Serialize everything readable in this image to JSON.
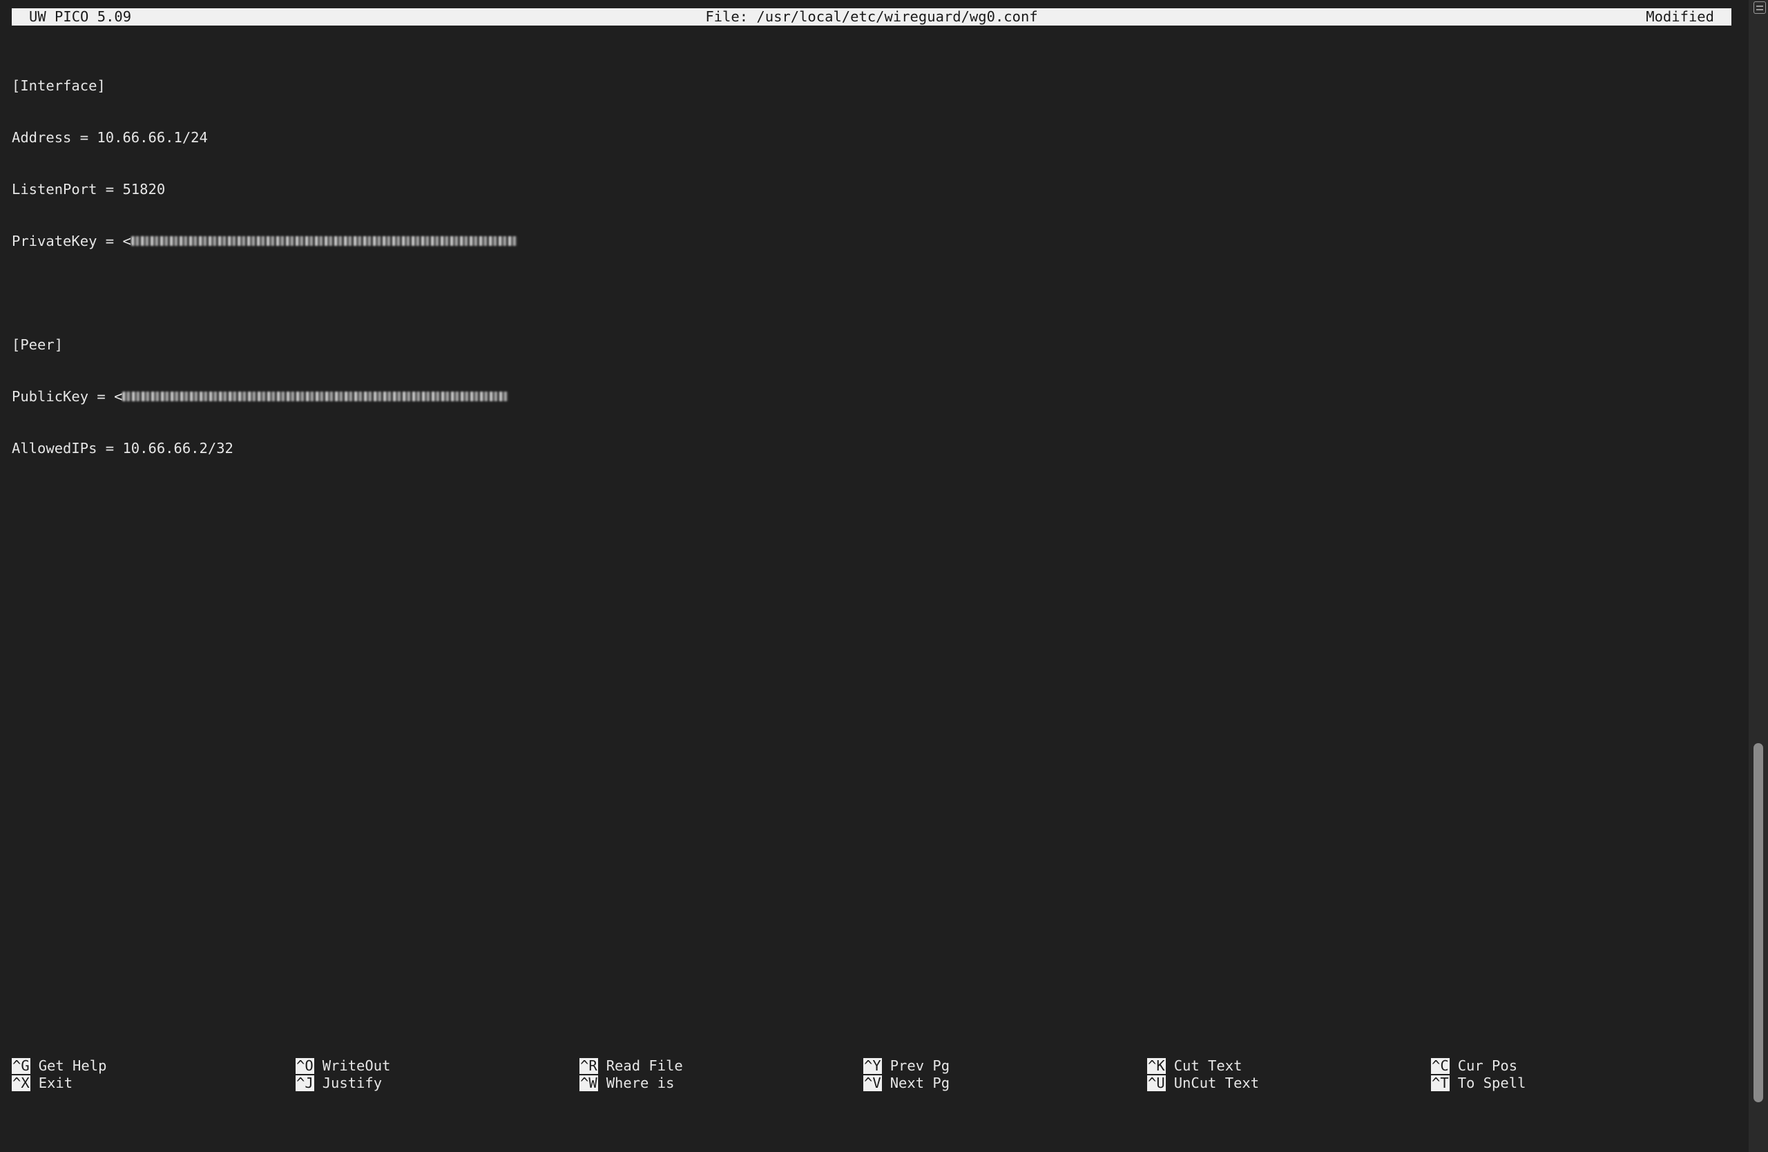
{
  "titlebar": {
    "app": "UW PICO 5.09",
    "file": "File: /usr/local/etc/wireguard/wg0.conf",
    "status": "Modified"
  },
  "editor": {
    "lines": [
      "[Interface]",
      "Address = 10.66.66.1/24",
      "ListenPort = 51820",
      "PrivateKey = <",
      "",
      "[Peer]",
      "PublicKey = <",
      "AllowedIPs = 10.66.66.2/32"
    ]
  },
  "shortcuts": [
    {
      "key": "^G",
      "label": "Get Help"
    },
    {
      "key": "^X",
      "label": "Exit"
    },
    {
      "key": "^O",
      "label": "WriteOut"
    },
    {
      "key": "^J",
      "label": "Justify"
    },
    {
      "key": "^R",
      "label": "Read File"
    },
    {
      "key": "^W",
      "label": "Where is"
    },
    {
      "key": "^Y",
      "label": "Prev Pg"
    },
    {
      "key": "^V",
      "label": "Next Pg"
    },
    {
      "key": "^K",
      "label": "Cut Text"
    },
    {
      "key": "^U",
      "label": "UnCut Text"
    },
    {
      "key": "^C",
      "label": "Cur Pos"
    },
    {
      "key": "^T",
      "label": "To Spell"
    }
  ],
  "colors": {
    "background": "#1f1f1f",
    "text": "#e6e6e6",
    "inverse_bg": "#f0f0f0"
  }
}
